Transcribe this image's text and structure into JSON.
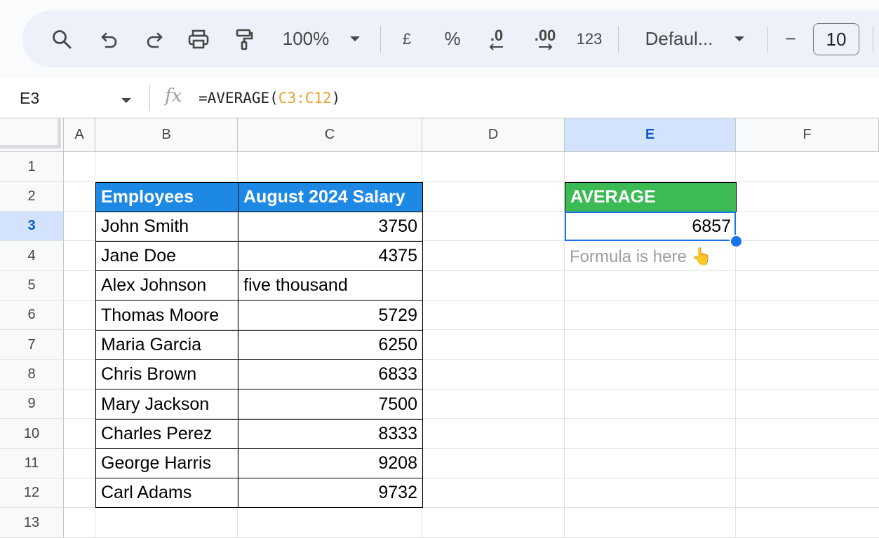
{
  "toolbar": {
    "zoom": "100%",
    "currency": "£",
    "percent": "%",
    "decrease_decimal": ".0",
    "increase_decimal": ".00",
    "number_format": "123",
    "font": "Defaul...",
    "font_size": "10",
    "minus": "−"
  },
  "formula_bar": {
    "name_box": "E3",
    "fx": "fx",
    "formula_prefix": "=AVERAGE(",
    "formula_ref": "C3:C12",
    "formula_suffix": ")"
  },
  "columns": [
    "A",
    "B",
    "C",
    "D",
    "E",
    "F"
  ],
  "rows": [
    "1",
    "2",
    "3",
    "4",
    "5",
    "6",
    "7",
    "8",
    "9",
    "10",
    "11",
    "12",
    "13"
  ],
  "table": {
    "headers": [
      "Employees",
      "August 2024 Salary"
    ],
    "rows": [
      [
        "John Smith",
        "3750"
      ],
      [
        "Jane Doe",
        "4375"
      ],
      [
        "Alex Johnson",
        "five thousand"
      ],
      [
        "Thomas Moore",
        "5729"
      ],
      [
        "Maria Garcia",
        "6250"
      ],
      [
        "Chris Brown",
        "6833"
      ],
      [
        "Mary Jackson",
        "7500"
      ],
      [
        "Charles Perez",
        "8333"
      ],
      [
        "George Harris",
        "9208"
      ],
      [
        "Carl Adams",
        "9732"
      ]
    ]
  },
  "average": {
    "label": "AVERAGE",
    "value": "6857",
    "note": "Formula is here 👆"
  },
  "colors": {
    "header_blue": "#1e88e5",
    "header_green": "#3cba54",
    "selection": "#1a73e8",
    "formula_ref": "#e8a12b"
  }
}
